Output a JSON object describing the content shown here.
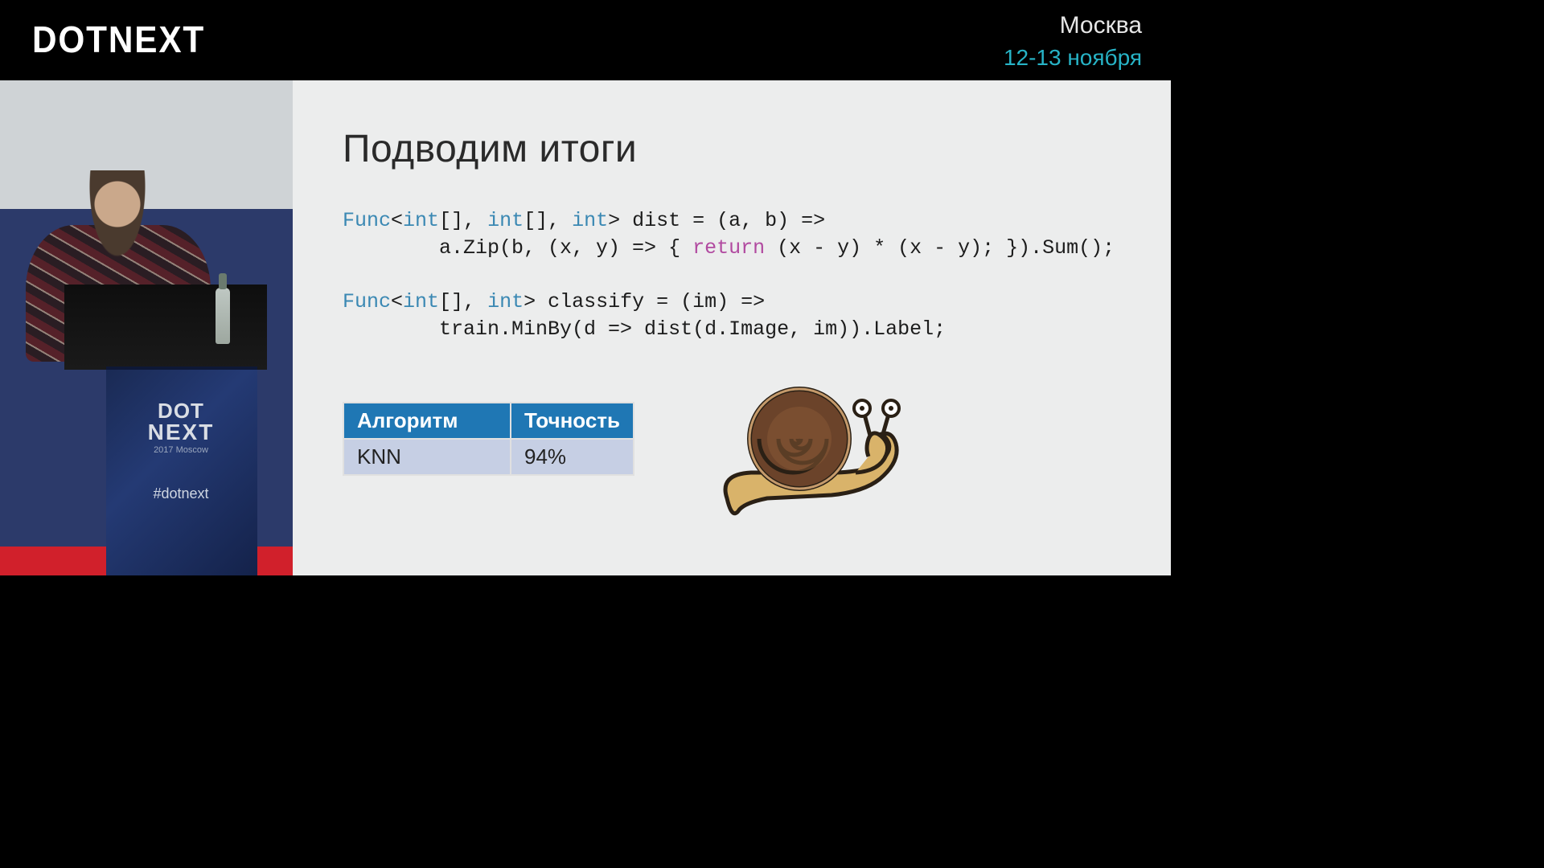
{
  "header": {
    "brand": "DOTNEXT",
    "city": "Москва",
    "date": "12-13 ноября"
  },
  "lectern": {
    "line1": "DOT",
    "line2": "NEXT",
    "year": "2017 Moscow",
    "hashtag": "#dotnext"
  },
  "slide": {
    "title": "Подводим итоги",
    "code": {
      "line1a": "Func",
      "line1b": "<",
      "line1c": "int",
      "line1d": "[], ",
      "line1e": "int",
      "line1f": "[], ",
      "line1g": "int",
      "line1h": "> dist = (a, b) =>",
      "line2a": "        a.Zip(b, (x, y) => { ",
      "line2b": "return",
      "line2c": " (x - y) * (x - y); }).Sum();",
      "line3": "",
      "line4a": "Func",
      "line4b": "<",
      "line4c": "int",
      "line4d": "[], ",
      "line4e": "int",
      "line4f": "> classify = (im) =>",
      "line5": "        train.MinBy(d => dist(d.Image, im)).Label;"
    },
    "table": {
      "h1": "Алгоритм",
      "h2": "Точность",
      "r1c1": "KNN",
      "r1c2": "94%"
    },
    "illustration": "snail-icon"
  }
}
